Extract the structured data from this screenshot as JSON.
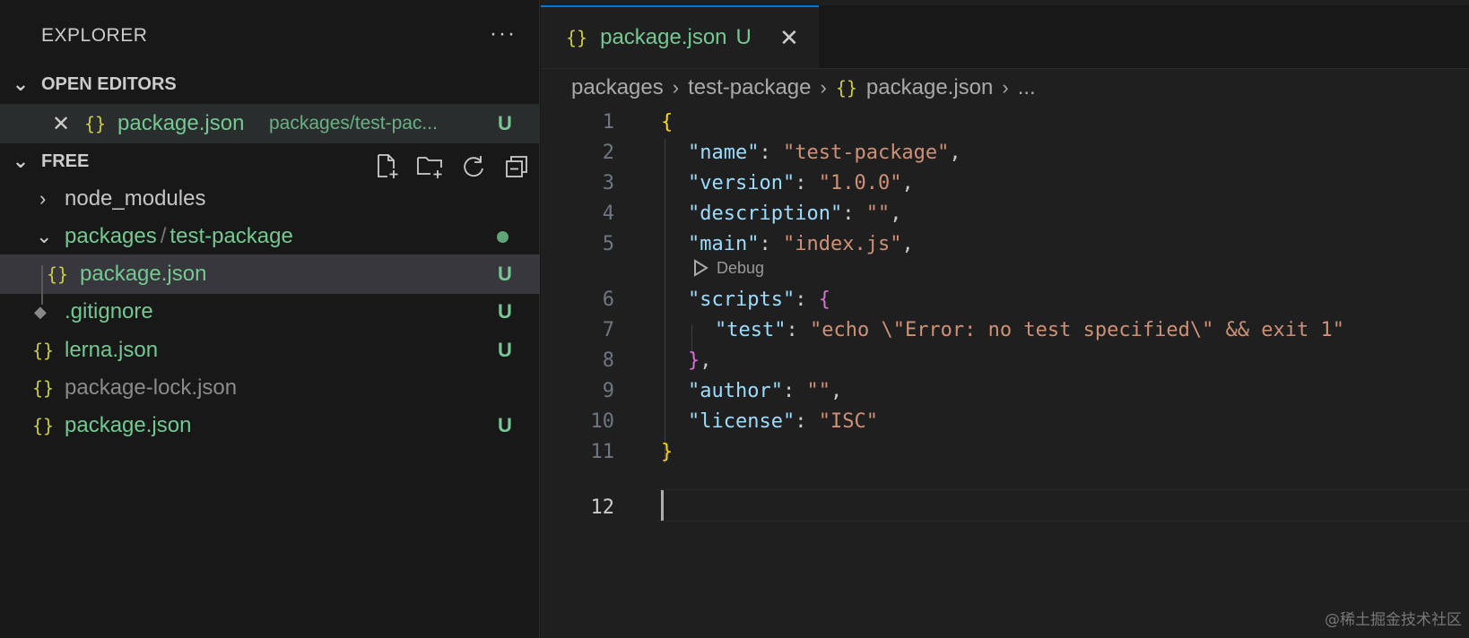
{
  "explorer": {
    "title": "EXPLORER",
    "more": "···",
    "open_editors": {
      "header": "OPEN EDITORS",
      "items": [
        {
          "icon": "{}",
          "name": "package.json",
          "path": "packages/test-pac...",
          "badge": "U"
        }
      ]
    },
    "workspace": {
      "header": "FREE",
      "tree": {
        "node_modules": "node_modules",
        "packages_a": "packages",
        "packages_sep": "/",
        "packages_b": "test-package",
        "package_json_nested": "package.json",
        "gitignore": ".gitignore",
        "lerna": "lerna.json",
        "package_lock": "package-lock.json",
        "package_json_root": "package.json",
        "badge_u": "U"
      }
    }
  },
  "editor": {
    "tab": {
      "icon": "{}",
      "label": "package.json",
      "badge": "U"
    },
    "breadcrumbs": [
      "packages",
      "test-package",
      "package.json",
      "..."
    ],
    "codelens": "Debug",
    "line_numbers": [
      "1",
      "2",
      "3",
      "4",
      "5",
      "6",
      "7",
      "8",
      "9",
      "10",
      "11",
      "12"
    ],
    "code": {
      "l1": "{",
      "l2_k": "\"name\"",
      "l2_v": "\"test-package\"",
      "l3_k": "\"version\"",
      "l3_v": "\"1.0.0\"",
      "l4_k": "\"description\"",
      "l4_v": "\"\"",
      "l5_k": "\"main\"",
      "l5_v": "\"index.js\"",
      "l6_k": "\"scripts\"",
      "l6_b": "{",
      "l7_k": "\"test\"",
      "l7_v": "\"echo \\\"Error: no test specified\\\" && exit 1\"",
      "l8_b": "}",
      "l9_k": "\"author\"",
      "l9_v": "\"\"",
      "l10_k": "\"license\"",
      "l10_v": "\"ISC\"",
      "l11": "}"
    }
  },
  "watermark": "@稀土掘金技术社区",
  "colors": {
    "git_untracked": "#73c991",
    "json_icon": "#cbcb41",
    "accent": "#0078d4"
  }
}
